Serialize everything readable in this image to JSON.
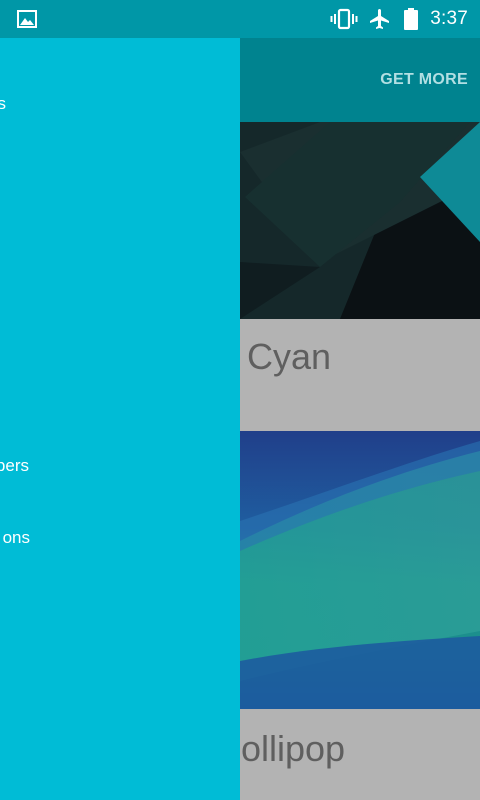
{
  "status_bar": {
    "time": "3:37",
    "icons": [
      "gallery-icon",
      "vibrate-icon",
      "airplane-icon",
      "battery-icon"
    ]
  },
  "toolbar": {
    "action_label": "GET MORE"
  },
  "drawer": {
    "items": [
      {
        "label": "s"
      },
      {
        "label": "pers"
      },
      {
        "label": "ons"
      }
    ]
  },
  "themes": [
    {
      "name": "Cyan"
    },
    {
      "name": "ollipop"
    }
  ],
  "colors": {
    "status_bar": "#0097a7",
    "toolbar": "#00838f",
    "drawer": "#00bcd6",
    "card_caption": "#b3b3b3"
  }
}
